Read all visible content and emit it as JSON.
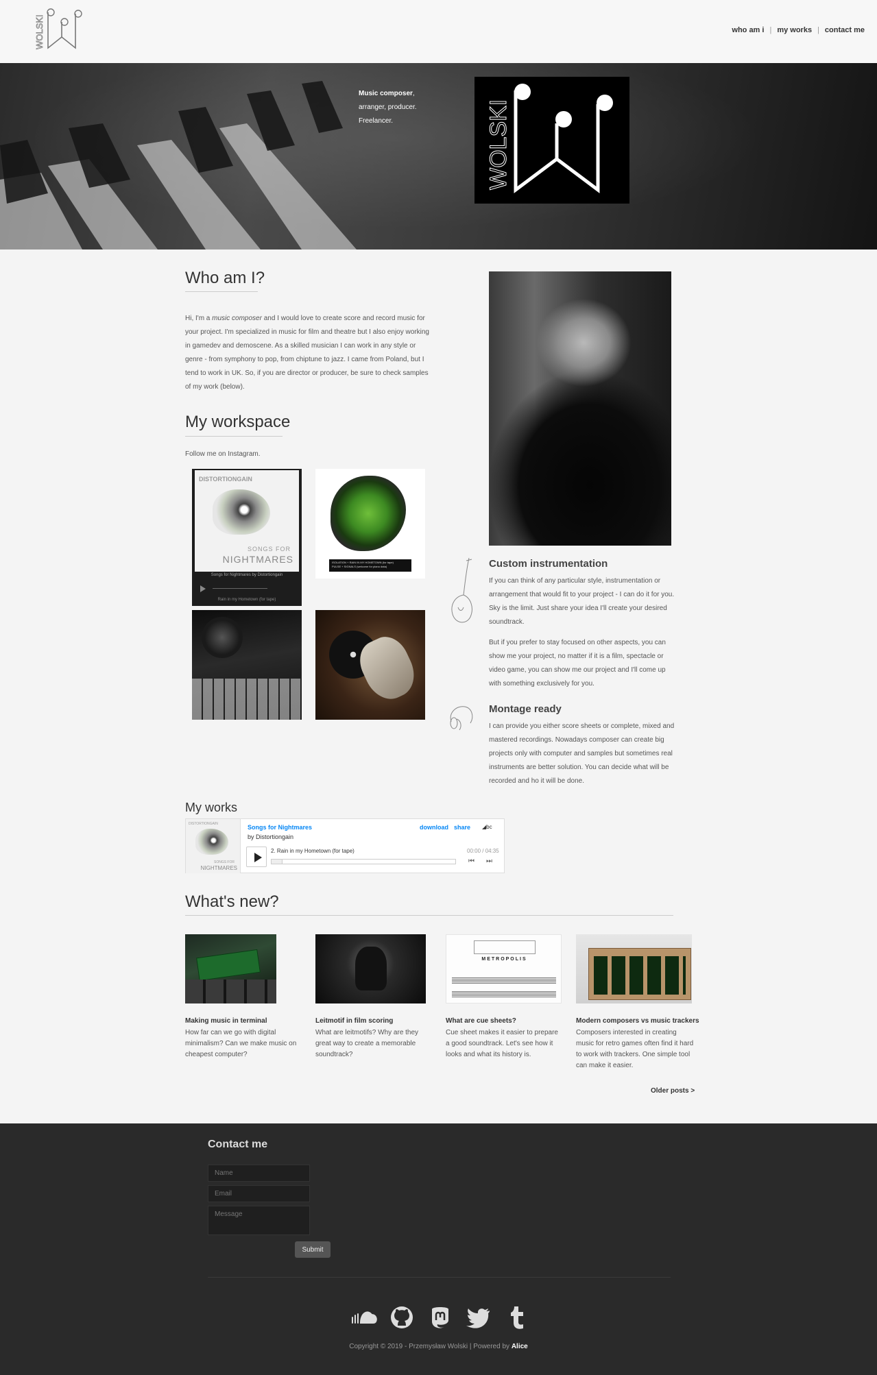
{
  "header": {
    "logo_text": "WOLSKI",
    "nav": [
      {
        "label": "who am i"
      },
      {
        "label": "my works"
      },
      {
        "label": "contact me"
      }
    ],
    "separator": "|"
  },
  "hero": {
    "line1_bold": "Music composer",
    "line1_tail": ",",
    "line2": "arranger, producer.",
    "line3": "Freelancer.",
    "logo_text": "WOLSKI"
  },
  "who": {
    "title": "Who am I?",
    "text_before": "Hi, I'm a ",
    "text_em": "music composer",
    "text_after": " and I would love to create score and record music for your project. I'm specialized in music for film and theatre but I also enjoy working in gamedev and demoscene. As a skilled musician I can work in any style or genre - from symphony to pop, from chiptune to jazz. I came from Poland, but I tend to work in UK. So, if you are director or producer, be sure to check samples of my work (below)."
  },
  "workspace": {
    "title": "My workspace",
    "follow": "Follow me on Instagram.",
    "tile1": {
      "label": "DISTORTIONGAIN",
      "songs": "SONGS FOR",
      "night": "NIGHTMARES",
      "caption": "Songs for Nightmares by Distortiongain",
      "caption2": "Rain in my Hometown (for tape)"
    },
    "tile2": {
      "strip1": "ISOLATION + RAIN IN MY HOMETOWN (for tape)",
      "strip2": "PULSE + SIGNALS (welcome for piano data)"
    }
  },
  "features": [
    {
      "title": "Custom instrumentation",
      "paragraphs": [
        "If you can think of any particular style, instrumentation or arrangement that would fit to your project - I can do it for you. Sky is the limit. Just share your idea I'll create your desired soundtrack.",
        "But if you prefer to stay focused on other aspects, you can show me your project, no matter if it is a film, spectacle or video game, you can show me our project and I'll come up with something exclusively for you."
      ],
      "icon": "violin-icon"
    },
    {
      "title": "Montage ready",
      "paragraphs": [
        "I can provide you either score sheets or complete, mixed and mastered recordings. Nowadays composer can create big projects only with computer and samples but sometimes real instruments are better solution. You can decide what will be recorded and ho it will be done."
      ],
      "icon": "headphones-icon"
    }
  ],
  "works": {
    "title": "My works",
    "player": {
      "cover_label": "DISTORTIONGAIN",
      "cover_songs": "SONGS FOR",
      "cover_night": "NIGHTMARES",
      "album": "Songs for Nightmares",
      "artist": "by Distortiongain",
      "download": "download",
      "share": "share",
      "bc": "bc",
      "track": "2.  Rain in my Hometown (for tape)",
      "time": "00:00 / 04:35",
      "progress": 0
    }
  },
  "news": {
    "title": "What's new?",
    "posts": [
      {
        "title": "Making music in terminal",
        "text": "How far can we go with digital minimalism? Can we make music on cheapest computer?"
      },
      {
        "title": "Leitmotif in film scoring",
        "text": "What are leitmotifs? Why are they great way to create a memorable soundtrack?"
      },
      {
        "title": "What are cue sheets?",
        "text": "Cue sheet makes it easier to prepare a good soundtrack. Let's see how it looks and what its history is.",
        "image_text": "METROPOLIS"
      },
      {
        "title": "Modern composers vs music trackers",
        "text": "Composers interested in creating music for retro games often find it hard to work with trackers. One simple tool can make it easier."
      }
    ],
    "older": "Older posts >"
  },
  "contact": {
    "title": "Contact me",
    "name_placeholder": "Name",
    "email_placeholder": "Email",
    "message_placeholder": "Message",
    "submit": "Submit"
  },
  "footer": {
    "socials": [
      "soundcloud-icon",
      "github-icon",
      "mastodon-icon",
      "twitter-icon",
      "tumblr-icon"
    ],
    "copyright": "Copyright © 2019 - Przemysław Wolski | Powered by ",
    "powered": "Alice"
  },
  "colors": {
    "accent_link": "#0687f5",
    "footer_bg": "#2a2a2a",
    "page_bg": "#f4f4f4"
  }
}
